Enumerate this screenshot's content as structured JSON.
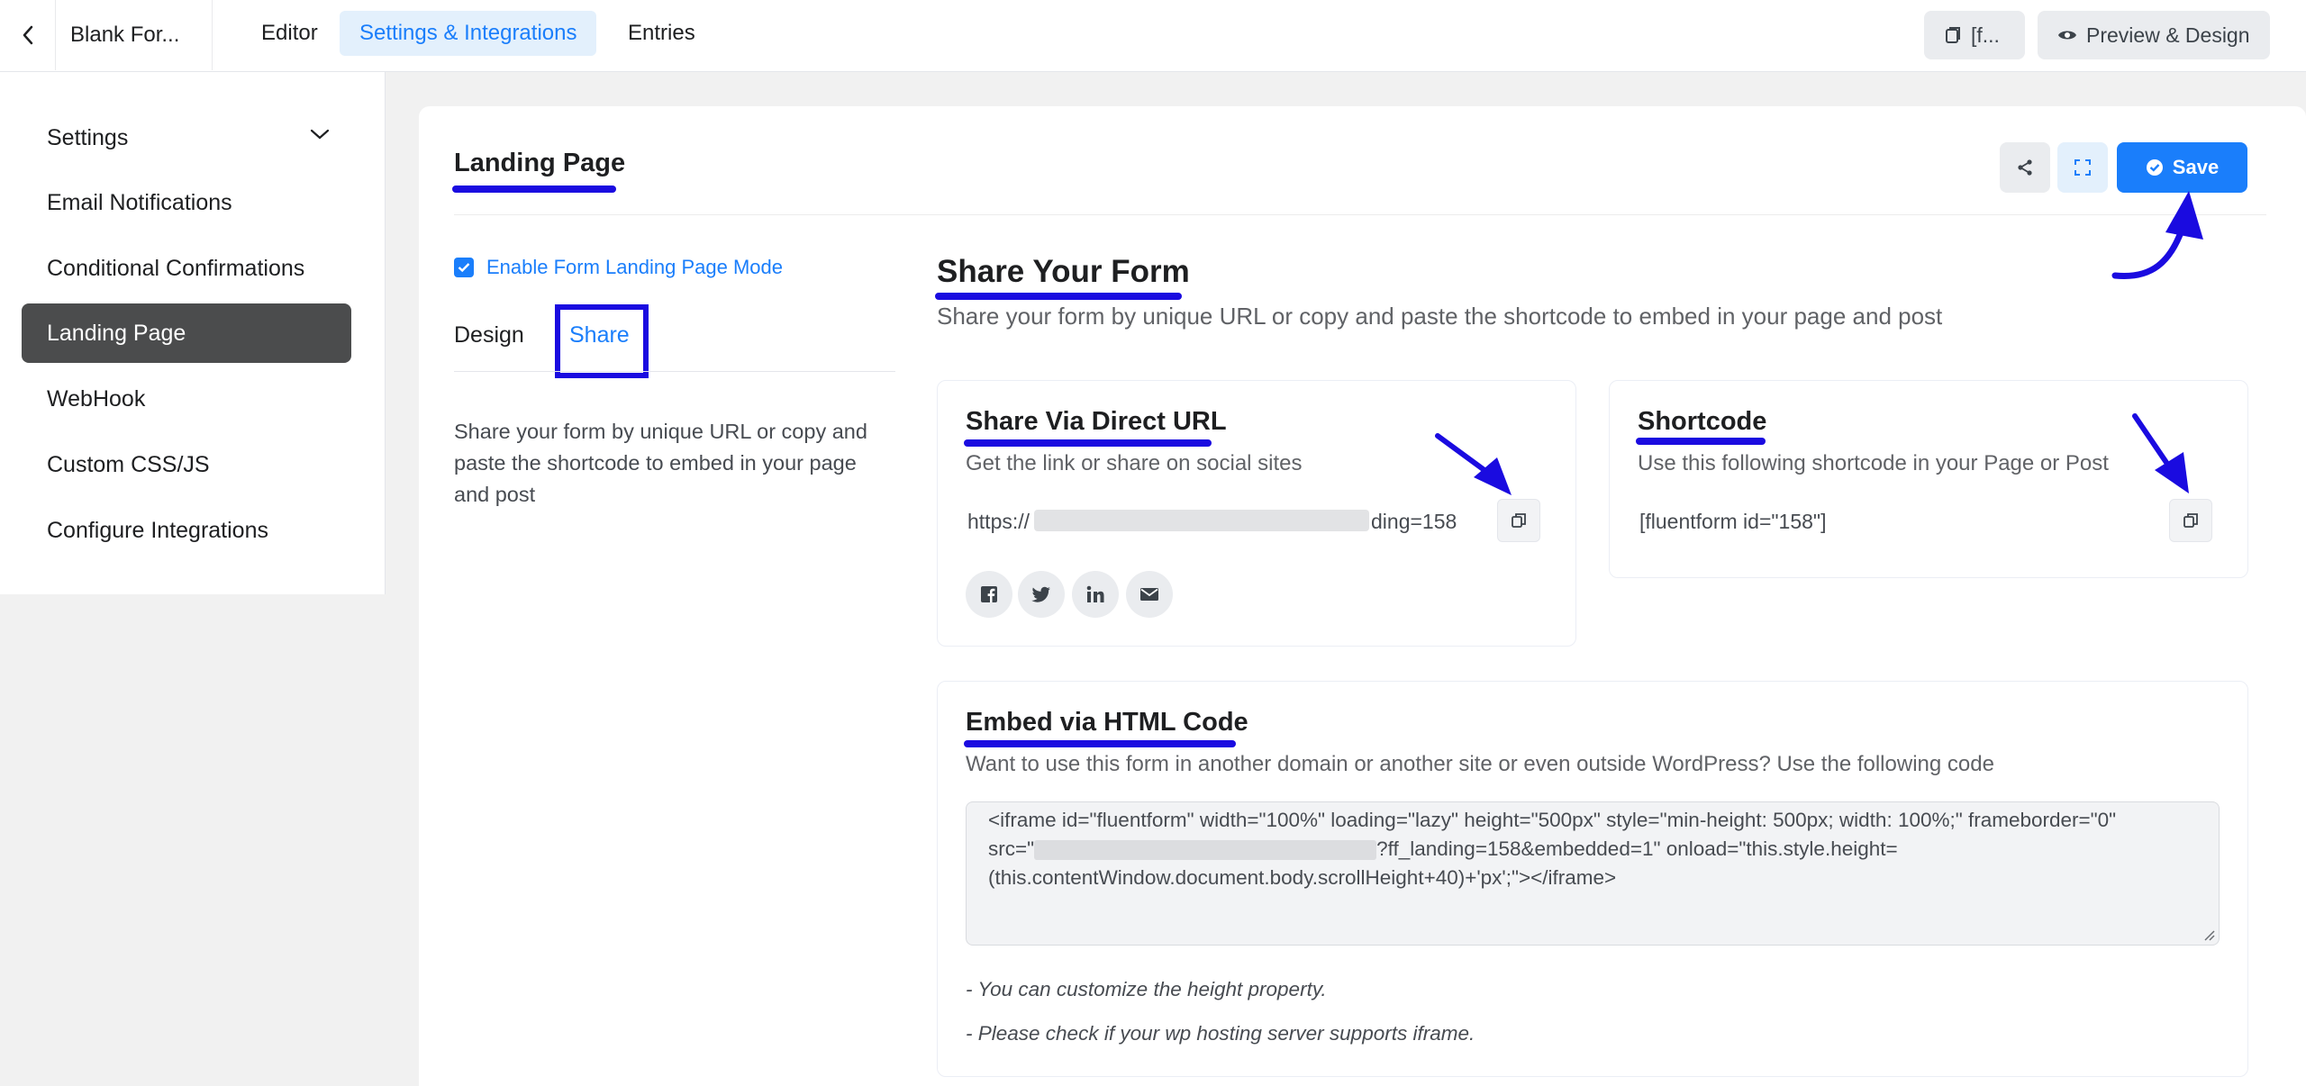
{
  "topbar": {
    "form_title": "Blank For...",
    "tabs": [
      {
        "label": "Editor",
        "active": false
      },
      {
        "label": "Settings & Integrations",
        "active": true
      },
      {
        "label": "Entries",
        "active": false
      }
    ],
    "shortcode_button": "[f...",
    "preview_button": "Preview & Design"
  },
  "sidebar": {
    "items": [
      {
        "label": "Settings",
        "active": false,
        "has_chevron": true
      },
      {
        "label": "Email Notifications",
        "active": false
      },
      {
        "label": "Conditional Confirmations",
        "active": false
      },
      {
        "label": "Landing Page",
        "active": true
      },
      {
        "label": "WebHook",
        "active": false
      },
      {
        "label": "Custom CSS/JS",
        "active": false
      },
      {
        "label": "Configure Integrations",
        "active": false
      }
    ]
  },
  "main": {
    "title": "Landing Page",
    "save_label": "Save",
    "enable_label": "Enable Form Landing Page Mode",
    "enable_checked": true,
    "sub_tabs": [
      {
        "label": "Design",
        "active": false
      },
      {
        "label": "Share",
        "active": true
      }
    ],
    "left_description": "Share your form by unique URL or copy and paste the shortcode to embed in your page and post",
    "share_title": "Share Your Form",
    "share_subtitle": "Share your form by unique URL or copy and paste the shortcode to embed in your page and post",
    "direct_url": {
      "title": "Share Via Direct URL",
      "subtitle": "Get the link or share on social sites",
      "url_prefix": "https://",
      "url_suffix": "ding=158",
      "social": [
        "facebook-icon",
        "twitter-icon",
        "linkedin-icon",
        "email-icon"
      ]
    },
    "shortcode": {
      "title": "Shortcode",
      "subtitle": "Use this following shortcode in your Page or Post",
      "value": "[fluentform id=\"158\"]"
    },
    "embed": {
      "title": "Embed via HTML Code",
      "subtitle": "Want to use this form in another domain or another site or even outside WordPress? Use the following code",
      "code_line1": "<iframe id=\"fluentform\" width=\"100%\" loading=\"lazy\" height=\"500px\" style=\"min-height: 500px; width: 100%;\" frameborder=\"0\"",
      "code_line2_prefix": "src=\"",
      "code_line2_suffix": "?ff_landing=158&embedded=1\" onload=\"this.style.height=",
      "code_line3": "(this.contentWindow.document.body.scrollHeight+40)+'px';\"></iframe>",
      "note1": "- You can customize the height property.",
      "note2": "- Please check if your wp hosting server supports iframe."
    }
  },
  "colors": {
    "accent": "#1a7efb",
    "annotation": "#1a0be0",
    "sidebar_active": "#4b4c4d"
  }
}
